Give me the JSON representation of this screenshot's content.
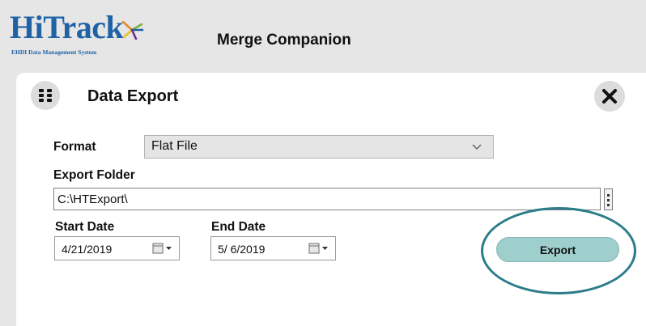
{
  "header": {
    "logo_text": "HiTrack",
    "logo_subtitle": "EHDI Data Management System",
    "app_title": "Merge Companion"
  },
  "panel": {
    "title": "Data Export",
    "menu_icon": "grid-menu-icon",
    "close_icon": "close-icon"
  },
  "form": {
    "format_label": "Format",
    "format_value": "Flat File",
    "export_folder_label": "Export Folder",
    "export_folder_value": "C:\\HTExport\\",
    "start_date_label": "Start Date",
    "start_date_value": "4/21/2019",
    "end_date_label": "End Date",
    "end_date_value": "5/ 6/2019",
    "export_button": "Export"
  },
  "colors": {
    "brand_blue": "#1f62a6",
    "export_button_bg": "#9fcfcd",
    "highlight_ring": "#2c7d8a",
    "app_background": "#e6e6e6"
  }
}
